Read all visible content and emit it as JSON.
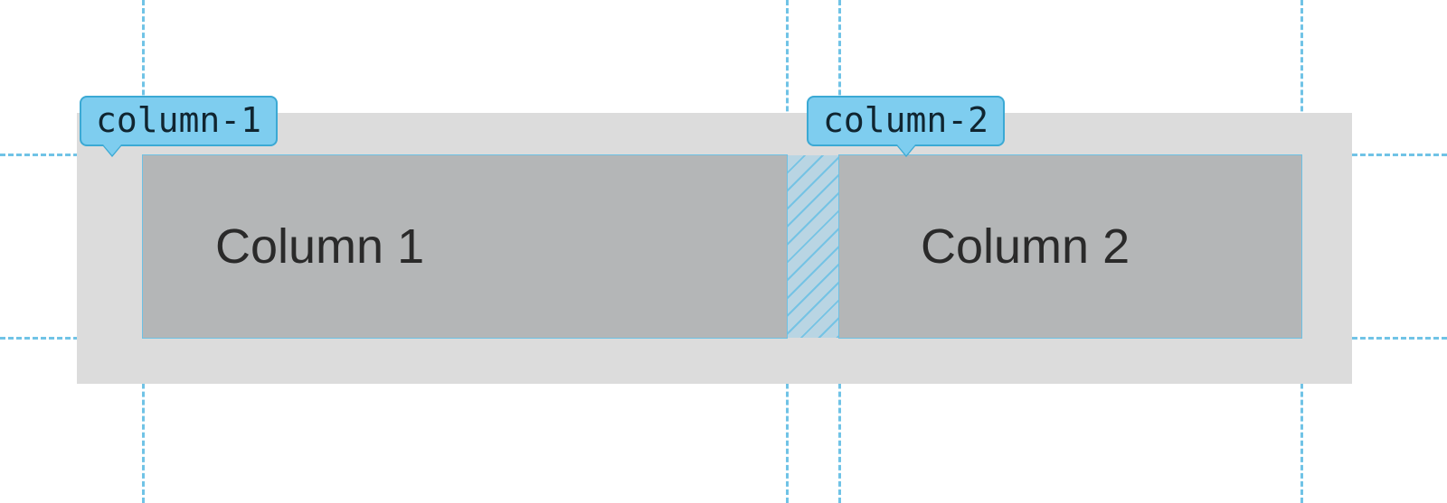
{
  "grid": {
    "container_bg": "#dcdcdc",
    "cell_bg": "#b4b6b7",
    "guide_color": "#70c3e6",
    "tag_bg": "#7ecdef",
    "tag_border": "#3ba9d4",
    "columns": [
      {
        "name": "column-1",
        "label": "Column 1"
      },
      {
        "name": "column-2",
        "label": "Column 2"
      }
    ]
  }
}
